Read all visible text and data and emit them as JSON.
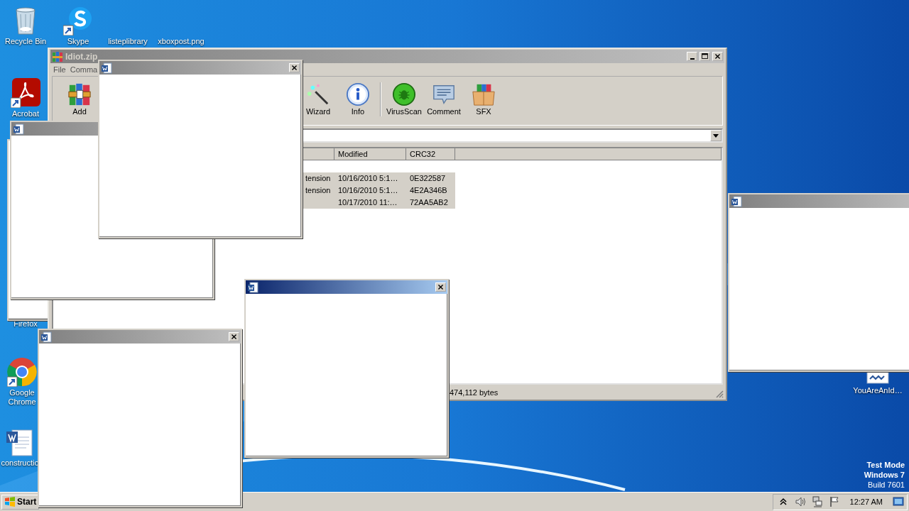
{
  "desktop_icons": [
    {
      "kind": "recycle",
      "label": "Recycle Bin"
    },
    {
      "kind": "skype",
      "label": "Skype"
    },
    {
      "kind": "none",
      "label": "listeplibrary"
    },
    {
      "kind": "none",
      "label": "xboxpost.png"
    },
    {
      "kind": "acrobat",
      "label": "Acrobat"
    },
    {
      "kind": "none",
      "label": "Firefox"
    },
    {
      "kind": "chrome",
      "label": "Google Chrome"
    },
    {
      "kind": "word",
      "label": "constructio"
    },
    {
      "kind": "doc",
      "label": "YouAreAnId…"
    }
  ],
  "archive_window": {
    "title": "Idiot.zip",
    "menu": [
      "File",
      "Comma"
    ],
    "toolbar": [
      {
        "kind": "add",
        "label": "Add"
      },
      {
        "kind": "wizard",
        "label": "Wizard"
      },
      {
        "kind": "info",
        "label": "Info"
      },
      {
        "kind": "virusscan",
        "label": "VirusScan"
      },
      {
        "kind": "comment",
        "label": "Comment"
      },
      {
        "kind": "sfx",
        "label": "SFX"
      }
    ],
    "columns": [
      "Modified",
      "CRC32"
    ],
    "rows": [
      {
        "column_1": "tension",
        "modified": "10/16/2010 5:1…",
        "crc32": "0E322587",
        "selected": true
      },
      {
        "column_1": "tension",
        "modified": "10/16/2010 5:1…",
        "crc32": "4E2A346B",
        "selected": true
      },
      {
        "modified": "10/17/2010 11:…",
        "crc32": "72AA5AB2",
        "selected": true
      }
    ],
    "status": "474,112 bytes"
  },
  "popups": [
    {
      "active": false
    },
    {
      "active": false
    },
    {
      "active": false
    },
    {
      "active": false
    },
    {
      "active": true
    }
  ],
  "taskbar": {
    "start": "Start",
    "clock": "12:27 AM"
  },
  "os_notice": [
    "Test Mode",
    "Windows 7",
    "Build 7601"
  ]
}
